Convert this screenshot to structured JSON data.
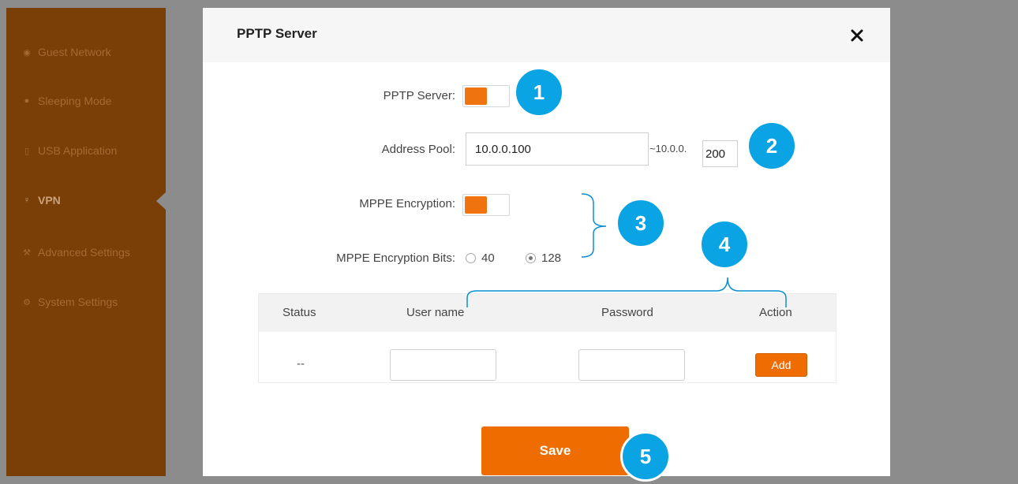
{
  "sidebar": {
    "items": [
      {
        "label": "Guest Network",
        "icon": "guest-network-icon"
      },
      {
        "label": "Sleeping Mode",
        "icon": "sleeping-mode-icon"
      },
      {
        "label": "USB Application",
        "icon": "usb-icon"
      },
      {
        "label": "VPN",
        "icon": "vpn-icon",
        "active": true
      },
      {
        "label": "Advanced Settings",
        "icon": "wrench-icon"
      },
      {
        "label": "System Settings",
        "icon": "gear-icon"
      }
    ]
  },
  "dialog": {
    "title": "PPTP Server",
    "close_icon": "close-icon"
  },
  "form": {
    "pptp_server_label": "PPTP Server:",
    "pptp_server_enabled": true,
    "address_pool_label": "Address Pool:",
    "address_pool_start": "10.0.0.100",
    "address_pool_prefix": "~10.0.0.",
    "address_pool_end": "200",
    "mppe_encryption_label": "MPPE Encryption:",
    "mppe_encryption_enabled": true,
    "mppe_bits_label": "MPPE Encryption Bits:",
    "mppe_bits_options": [
      "40",
      "128"
    ],
    "mppe_bits_selected": "128"
  },
  "table": {
    "headers": [
      "Status",
      "User name",
      "Password",
      "Action"
    ],
    "row": {
      "status": "--",
      "username": "",
      "password": "",
      "action_label": "Add"
    }
  },
  "save_label": "Save",
  "callouts": [
    "1",
    "2",
    "3",
    "4",
    "5"
  ],
  "colors": {
    "accent": "#ef6c00",
    "callout": "#0aa3e4",
    "sidebar": "#7a3f06"
  }
}
